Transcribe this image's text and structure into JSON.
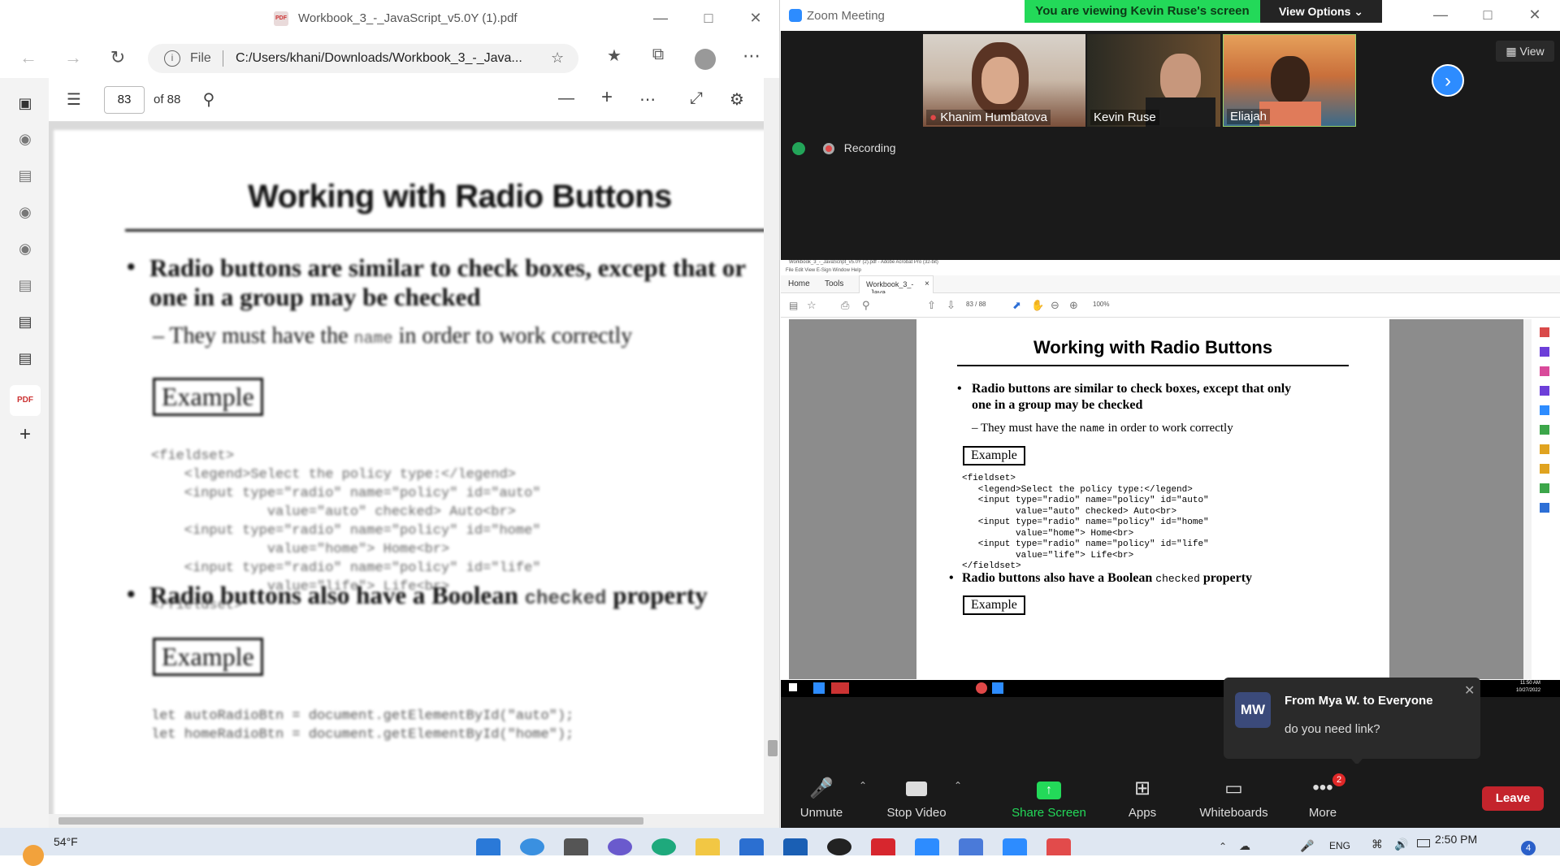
{
  "edge": {
    "tab_title": "Workbook_3_-_JavaScript_v5.0Y (1).pdf",
    "address_label": "File",
    "address_url": "C:/Users/khani/Downloads/Workbook_3_-_Java...",
    "page_number": "83",
    "page_total": "of 88",
    "pdf": {
      "title": "Working with Radio Buttons",
      "bullet1_line1": "Radio buttons are similar to check boxes, except that or",
      "bullet1_line2": "one in a group may be checked",
      "sub1_prefix": "– They must have the ",
      "sub1_code": "name",
      "sub1_suffix": " in order to work correctly",
      "example1": "Example",
      "code1": "<fieldset>\n    <legend>Select the policy type:</legend>\n    <input type=\"radio\" name=\"policy\" id=\"auto\"\n              value=\"auto\" checked> Auto<br>\n    <input type=\"radio\" name=\"policy\" id=\"home\"\n              value=\"home\"> Home<br>\n    <input type=\"radio\" name=\"policy\" id=\"life\"\n              value=\"life\"> Life<br>\n</fieldset>",
      "bullet2_prefix": "Radio buttons also have a Boolean ",
      "bullet2_code": "checked",
      "bullet2_suffix": " property",
      "example2": "Example",
      "code2": "let autoRadioBtn = document.getElementById(\"auto\");\nlet homeRadioBtn = document.getElementById(\"home\");"
    }
  },
  "zoom": {
    "title": "Zoom Meeting",
    "banner": "You are viewing Kevin Ruse's screen",
    "view_options": "View Options",
    "view_button": "View",
    "participants": [
      "Khanim Humbatova",
      "Kevin Ruse",
      "Eliajah"
    ],
    "recording": "Recording",
    "shared": {
      "window_title": "Workbook_3_-_JavaScript_v5.0Y (2).pdf - Adobe Acrobat Pro (32-bit)",
      "menu": "File  Edit  View  E-Sign  Window  Help",
      "tab_home": "Home",
      "tab_tools": "Tools",
      "tab_doc": "Workbook_3_-_Java...",
      "page_field": "83  /  88",
      "zoom_level": "100%",
      "title": "Working with Radio Buttons",
      "bullet1_line1": "Radio buttons are similar to check boxes, except that only",
      "bullet1_line2": "one in a group may be checked",
      "sub1_prefix": "– They must have the ",
      "sub1_code": "name",
      "sub1_suffix": " in order to work correctly",
      "example1": "Example",
      "code1": "<fieldset>\n   <legend>Select the policy type:</legend>\n   <input type=\"radio\" name=\"policy\" id=\"auto\"\n          value=\"auto\" checked> Auto<br>\n   <input type=\"radio\" name=\"policy\" id=\"home\"\n          value=\"home\"> Home<br>\n   <input type=\"radio\" name=\"policy\" id=\"life\"\n          value=\"life\"> Life<br>\n</fieldset>",
      "bullet2_prefix": "Radio buttons also have a Boolean ",
      "bullet2_code": "checked",
      "bullet2_suffix": " property",
      "example2": "Example",
      "remote_clock": "11:50 AM",
      "remote_date": "10/27/2022"
    },
    "chat": {
      "initials": "MW",
      "from": "From Mya W. to Everyone",
      "message": "do you need link?"
    },
    "controls": {
      "unmute": "Unmute",
      "stop_video": "Stop Video",
      "share_screen": "Share Screen",
      "apps": "Apps",
      "whiteboards": "Whiteboards",
      "more": "More",
      "more_badge": "2",
      "leave": "Leave"
    }
  },
  "taskbar": {
    "weather": "54°F",
    "language": "ENG",
    "time": "2:50 PM",
    "notification_badge": "4"
  },
  "colors": {
    "zoom_green": "#23d959",
    "zoom_blue": "#2d8cff",
    "leave_red": "#c4242c",
    "share_green": "#23d959"
  }
}
